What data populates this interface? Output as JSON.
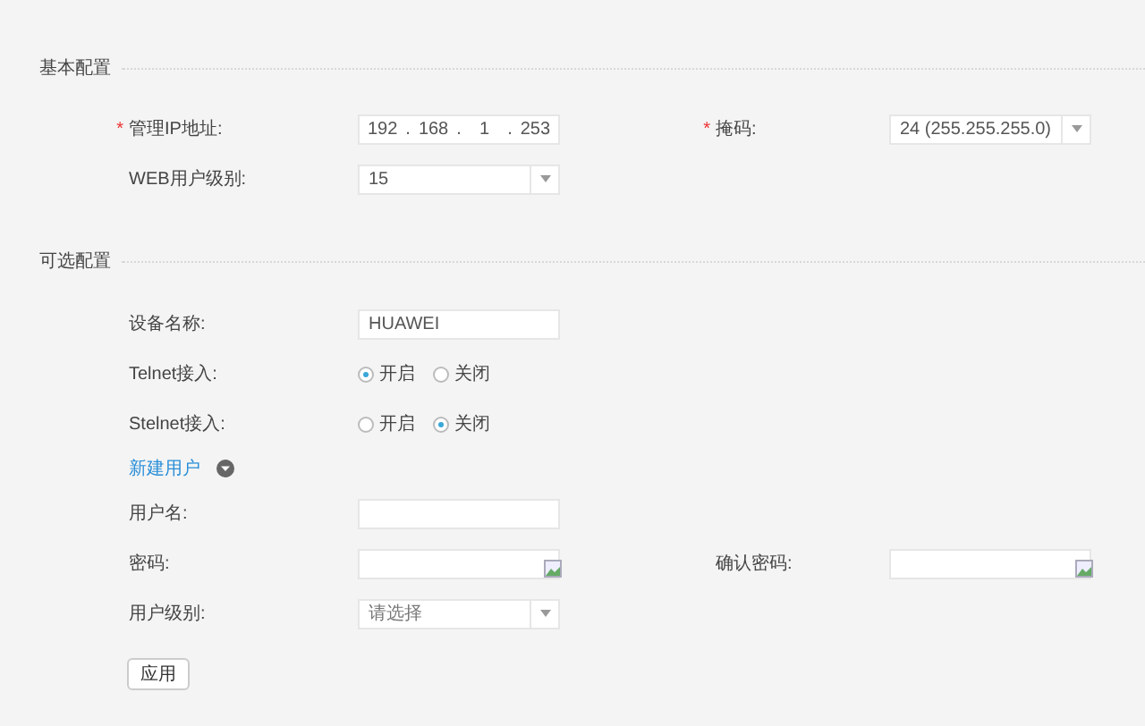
{
  "sections": [
    {
      "title": "基本配置",
      "rows": [
        {
          "kind": "fields",
          "fields": [
            {
              "kind": "ip",
              "label": "管理IP地址:",
              "marker": "*",
              "octets": [
                "192",
                "168",
                "1",
                "253"
              ],
              "separators": [
                ".",
                ".",
                "."
              ]
            },
            {
              "kind": "select",
              "label": "掩码:",
              "marker": "*",
              "value": "24 (255.255.255.0)"
            }
          ]
        },
        {
          "kind": "fields",
          "fields": [
            {
              "kind": "select",
              "label": "WEB用户级别:",
              "value": "15"
            }
          ]
        }
      ]
    },
    {
      "title": "可选配置",
      "rows": [
        {
          "kind": "fields",
          "fields": [
            {
              "kind": "text",
              "label": "设备名称:",
              "value": "HUAWEI"
            }
          ]
        },
        {
          "kind": "fields",
          "fields": [
            {
              "kind": "radio",
              "label": "Telnet接入:",
              "options": [
                {
                  "label": "开启",
                  "selected": true
                },
                {
                  "label": "关闭",
                  "selected": false
                }
              ]
            }
          ]
        },
        {
          "kind": "fields",
          "fields": [
            {
              "kind": "radio",
              "label": "Stelnet接入:",
              "options": [
                {
                  "label": "开启",
                  "selected": false
                },
                {
                  "label": "关闭",
                  "selected": true
                }
              ]
            }
          ]
        },
        {
          "kind": "link",
          "label": "新建用户",
          "expanded": false
        },
        {
          "kind": "fields",
          "fields": [
            {
              "kind": "text",
              "label": "用户名:"
            }
          ]
        },
        {
          "kind": "fields",
          "fields": [
            {
              "kind": "password",
              "label": "密码:"
            },
            {
              "kind": "password",
              "label": "确认密码:"
            }
          ]
        },
        {
          "kind": "fields",
          "fields": [
            {
              "kind": "select",
              "label": "用户级别:",
              "placeholder": "请选择"
            }
          ]
        },
        {
          "kind": "button",
          "label": "应用"
        }
      ]
    }
  ]
}
